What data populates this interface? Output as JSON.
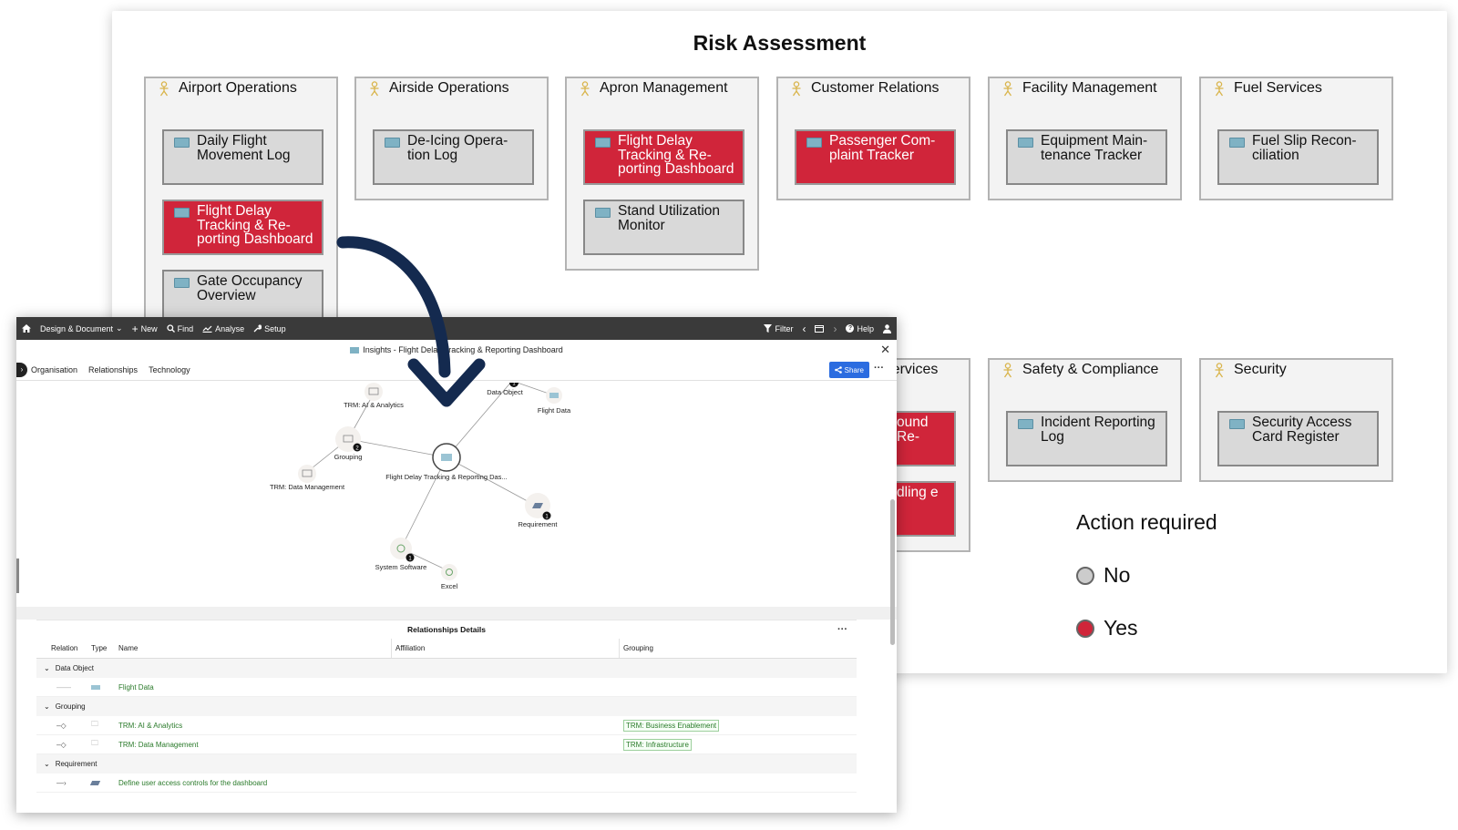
{
  "risk": {
    "title": "Risk Assessment",
    "capabilities": [
      {
        "name": "Airport Operations",
        "apps": [
          {
            "name": "Daily Flight Movement Log",
            "red": false
          },
          {
            "name": "Flight Delay Tracking & Re-porting Dashboard",
            "red": true
          },
          {
            "name": "Gate Occupancy Overview",
            "red": false
          }
        ]
      },
      {
        "name": "Airside Operations",
        "apps": [
          {
            "name": "De-Icing Opera-tion Log",
            "red": false
          }
        ]
      },
      {
        "name": "Apron Management",
        "apps": [
          {
            "name": "Flight Delay Tracking & Re-porting Dashboard",
            "red": true
          },
          {
            "name": "Stand Utilization Monitor",
            "red": false
          }
        ]
      },
      {
        "name": "Customer Relations",
        "apps": [
          {
            "name": "Passenger Com-plaint Tracker",
            "red": true
          }
        ]
      },
      {
        "name": "Facility Management",
        "apps": [
          {
            "name": "Equipment Main-tenance Tracker",
            "red": false
          }
        ]
      },
      {
        "name": "Fuel Services",
        "apps": [
          {
            "name": "Fuel Slip Recon-ciliation",
            "red": false
          }
        ]
      },
      {
        "name": "Services",
        "apps": [
          {
            "name": "ound Re-",
            "red": true
          },
          {
            "name": "dling e",
            "red": true
          }
        ]
      },
      {
        "name": "Safety & Compliance",
        "apps": [
          {
            "name": "Incident Reporting Log",
            "red": false
          }
        ]
      },
      {
        "name": "Security",
        "apps": [
          {
            "name": "Security Access Card Register",
            "red": false
          }
        ]
      }
    ],
    "legend": {
      "title": "Action required",
      "no": "No",
      "yes": "Yes",
      "no_color": "#cccccc",
      "yes_color": "#d0253a"
    }
  },
  "insights": {
    "topbar": {
      "design": "Design & Document",
      "new": "New",
      "find": "Find",
      "analyse": "Analyse",
      "setup": "Setup",
      "filter": "Filter",
      "help": "Help"
    },
    "title": "Insights - Flight Delay Tracking & Reporting Dashboard",
    "tabs": [
      "Organisation",
      "Relationships",
      "Technology"
    ],
    "share": "Share",
    "graph": {
      "center": "Flight Delay Tracking & Reporting Das...",
      "nodes": {
        "trm_ai": "TRM: AI & Analytics",
        "grouping": "Grouping",
        "trm_dm": "TRM: Data Management",
        "data_object": "Data Object",
        "flight_data": "Flight Data",
        "requirement": "Requirement",
        "system_software": "System Software",
        "excel": "Excel"
      },
      "counts": {
        "grouping": "2",
        "data_object": "1",
        "requirement": "1",
        "system_software": "1"
      }
    },
    "details": {
      "title": "Relationships Details",
      "headers": [
        "Relation",
        "Type",
        "Name",
        "Affiliation",
        "Grouping"
      ],
      "groups": {
        "data_object": "Data Object",
        "grouping": "Grouping",
        "requirement": "Requirement"
      },
      "rows": {
        "flight_data": "Flight Data",
        "trm_ai": "TRM: AI & Analytics",
        "trm_ai_group": "TRM: Business Enablement",
        "trm_dm": "TRM: Data Management",
        "trm_dm_group": "TRM: Infrastructure",
        "req": "Define user access controls for the dashboard"
      }
    }
  }
}
